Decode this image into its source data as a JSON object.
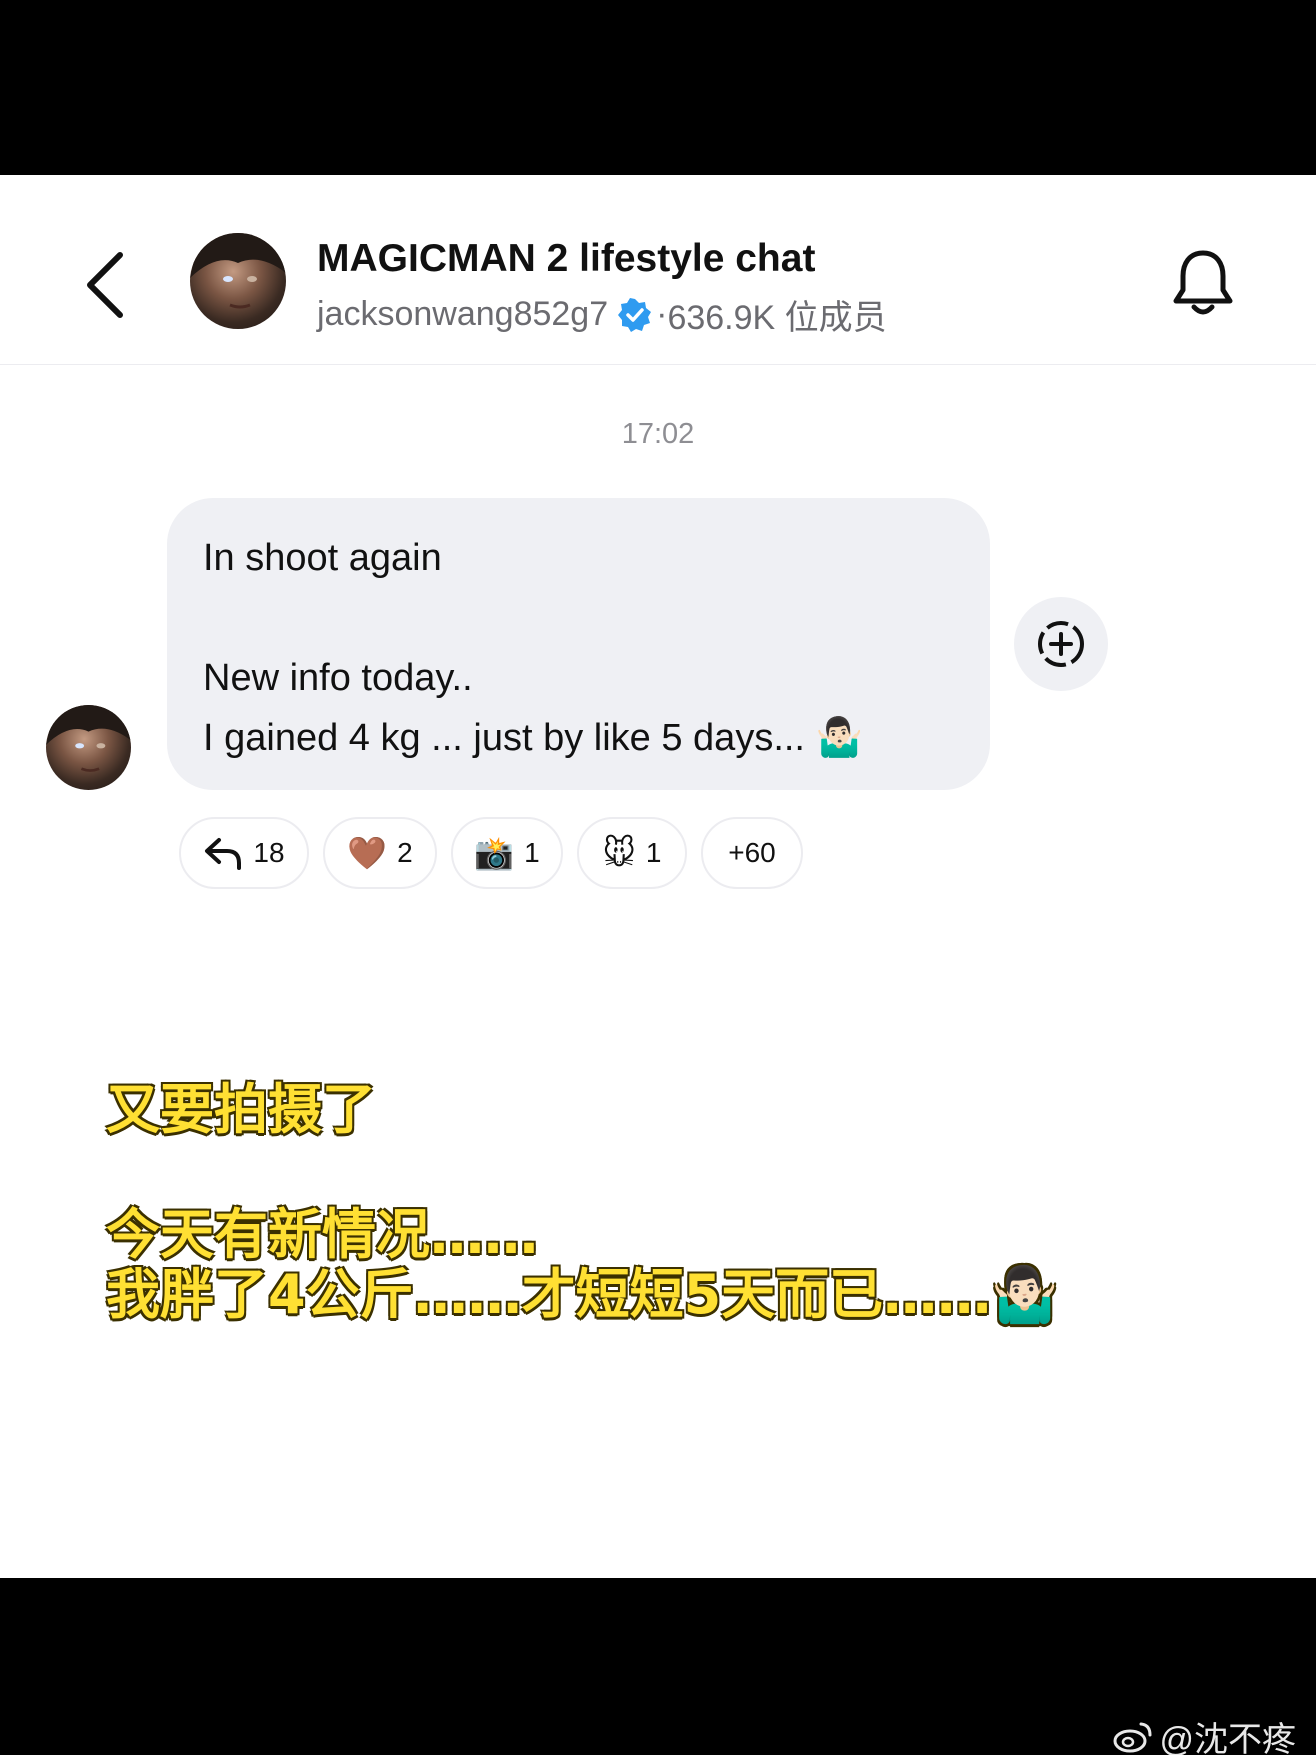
{
  "header": {
    "title": "MAGICMAN 2 lifestyle chat",
    "username": "jacksonwang852g7",
    "separator": "·",
    "members": "636.9K 位成员"
  },
  "chat": {
    "timestamp": "17:02",
    "message": "In shoot again\n\nNew info today..\nI gained 4 kg ... just by like 5 days... 🤷🏻‍♂️",
    "reactions": [
      {
        "icon": "reply-icon",
        "emoji": "",
        "count": "18"
      },
      {
        "icon": "brown-heart-icon",
        "emoji": "🤎",
        "count": "2"
      },
      {
        "icon": "camera-flash-icon",
        "emoji": "📸",
        "count": "1"
      },
      {
        "icon": "mouse-face-icon",
        "emoji": "🐭",
        "count": "1"
      },
      {
        "icon": "",
        "emoji": "",
        "count": "+60"
      }
    ]
  },
  "captions": {
    "line1": "又要拍摄了",
    "line2": "今天有新情况……",
    "line3": "我胖了4公斤……才短短5天而已……🤷🏻‍♂️"
  },
  "watermark": "@沈不疼",
  "colors": {
    "bubble": "#eff0f4",
    "verified": "#2f9bf0",
    "caption": "#ffe033"
  }
}
